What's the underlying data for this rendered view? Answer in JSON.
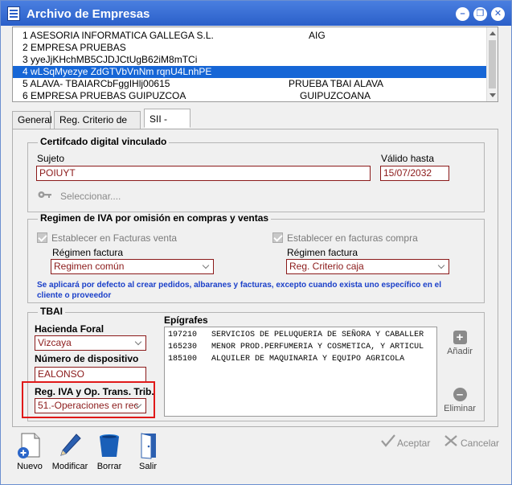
{
  "window": {
    "title": "Archivo de Empresas"
  },
  "companies": [
    {
      "line": "1 ASESORIA INFORMATICA GALLEGA S.L.",
      "extra": "AIG",
      "selected": false
    },
    {
      "line": "2 EMPRESA PRUEBAS",
      "extra": "",
      "selected": false
    },
    {
      "line": "3 yyeJjKHchMB5CJDJCtUgB62iM8mTCi",
      "extra": "",
      "selected": false
    },
    {
      "line": "4 wLSqMyezye ZdGTVbVnNm rqnU4LnhPE",
      "extra": "",
      "selected": true
    },
    {
      "line": "5 ALAVA- TBAIARCbFggIHlj00615",
      "extra": "PRUEBA TBAI ALAVA",
      "selected": false
    },
    {
      "line": "6 EMPRESA PRUEBAS GUIPUZCOA",
      "extra": "GUIPUZCOANA",
      "selected": false
    }
  ],
  "tabs": [
    {
      "label": "General",
      "active": false
    },
    {
      "label": "Reg. Criterio de caja",
      "active": false
    },
    {
      "label": "SII - TBAI",
      "active": true
    }
  ],
  "cert": {
    "legend": "Certifcado digital vinculado",
    "subject_label": "Sujeto",
    "subject_value": "POIUYT",
    "valid_label": "Válido hasta",
    "valid_value": "15/07/2032",
    "select_label": "Seleccionar...."
  },
  "iva": {
    "legend": "Regimen de IVA por omisión en compras y ventas",
    "sales_check": "Establecer en Facturas venta",
    "purchase_check": "Establecer en facturas compra",
    "regime_label": "Régimen factura",
    "sales_value": "Regimen común",
    "purchase_value": "Reg. Criterio caja",
    "note": "Se aplicará por defecto al crear pedidos, albaranes y facturas, excepto cuando exista uno específico en el cliente o proveedor"
  },
  "tbai": {
    "legend": "TBAI",
    "hacienda_label": "Hacienda Foral",
    "hacienda_value": "Vizcaya",
    "device_label": "Número de dispositivo",
    "device_value": "EALONSO",
    "regiva_label": "Reg. IVA y Op. Trans. Trib.",
    "regiva_value": "51.-Operaciones en rec",
    "epigrafes_label": "Epígrafes",
    "epigrafes": [
      {
        "code": "197210",
        "desc": "SERVICIOS DE PELUQUERIA DE SEÑORA Y CABALLER"
      },
      {
        "code": "165230",
        "desc": "MENOR PROD.PERFUMERIA Y COSMETICA, Y ARTICUL"
      },
      {
        "code": "185100",
        "desc": "ALQUILER DE MAQUINARIA Y EQUIPO AGRICOLA"
      }
    ],
    "add_label": "Añadir",
    "remove_label": "Eliminar"
  },
  "toolbar": {
    "new": "Nuevo",
    "edit": "Modificar",
    "delete": "Borrar",
    "exit": "Salir"
  },
  "footer": {
    "accept": "Aceptar",
    "cancel": "Cancelar"
  }
}
